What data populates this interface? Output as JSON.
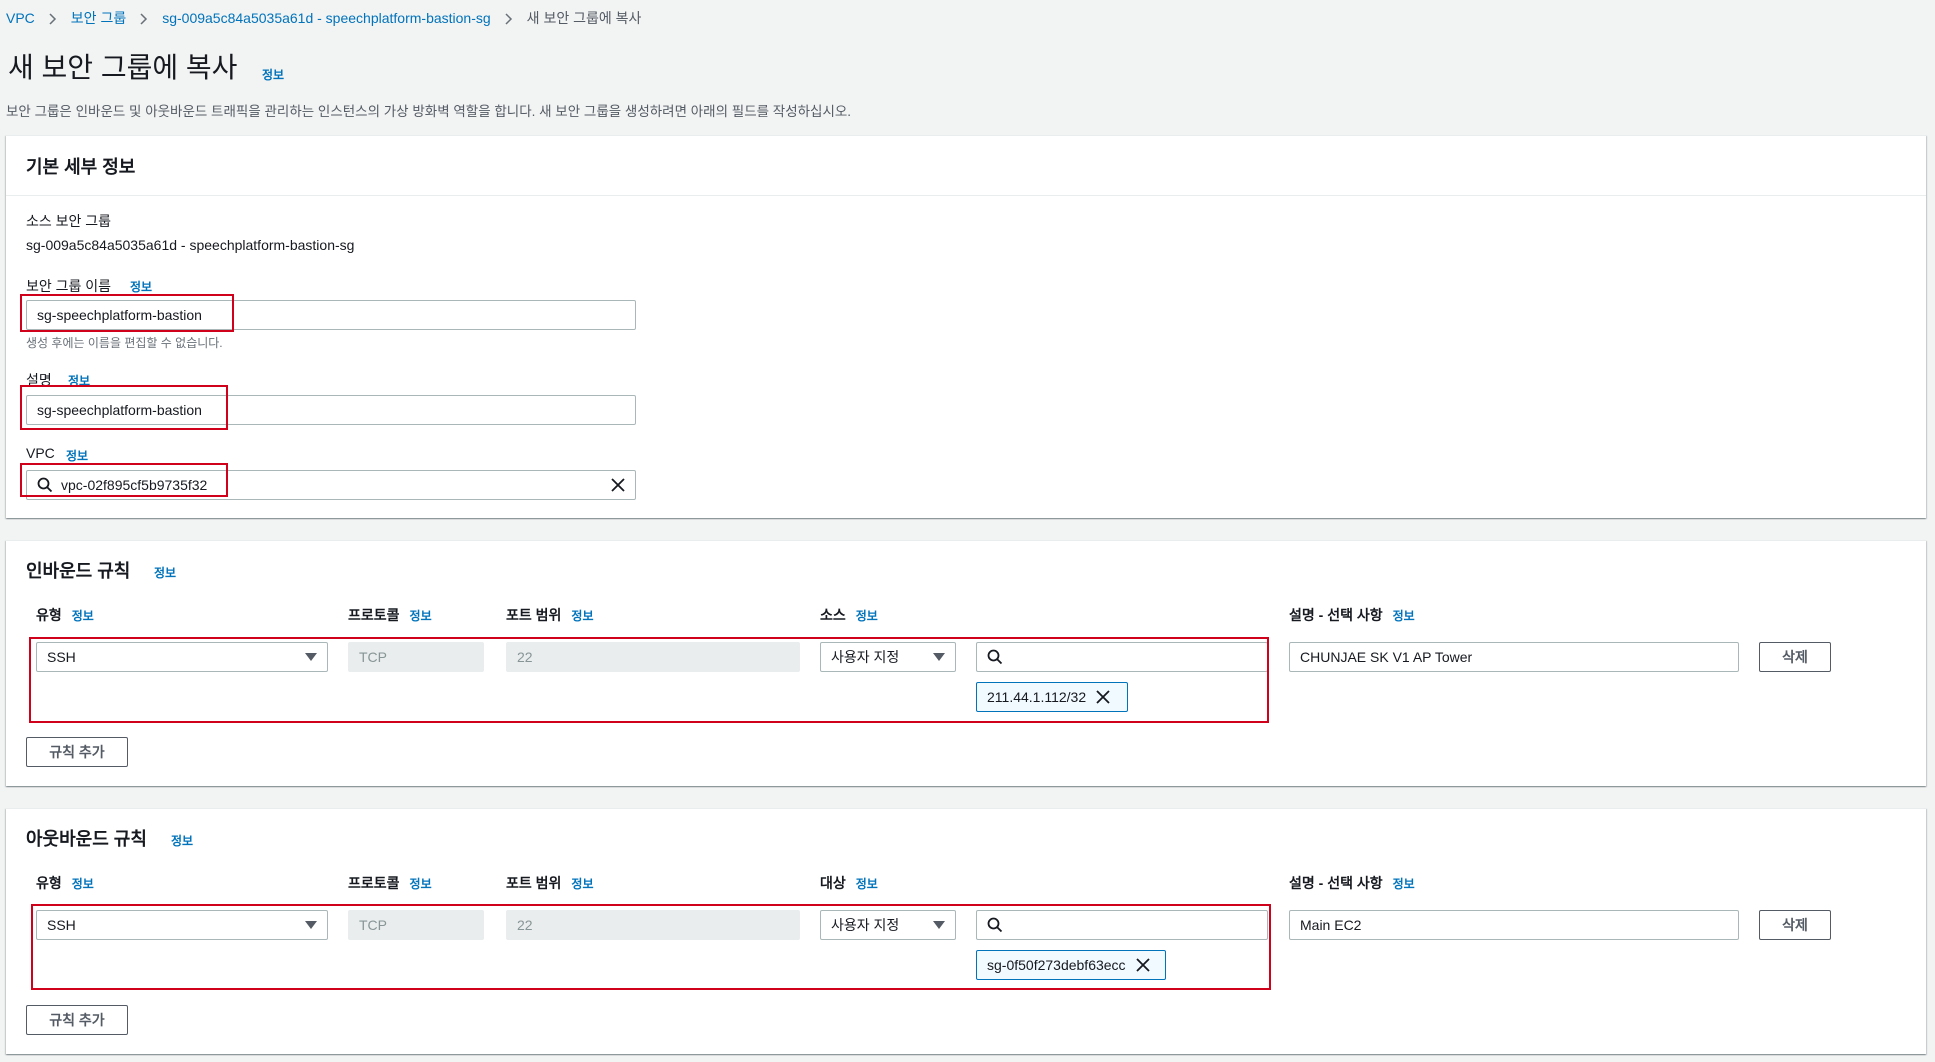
{
  "breadcrumb": {
    "items": [
      "VPC",
      "보안 그룹",
      "sg-009a5c84a5035a61d - speechplatform-bastion-sg"
    ],
    "current": "새 보안 그룹에 복사"
  },
  "page": {
    "title": "새 보안 그룹에 복사",
    "info": "정보",
    "description": "보안 그룹은 인바운드 및 아웃바운드 트래픽을 관리하는 인스턴스의 가상 방화벽 역할을 합니다. 새 보안 그룹을 생성하려면 아래의 필드를 작성하십시오."
  },
  "basic": {
    "title": "기본 세부 정보",
    "source_label": "소스 보안 그룹",
    "source_value": "sg-009a5c84a5035a61d - speechplatform-bastion-sg",
    "name_label": "보안 그룹 이름",
    "name_info": "정보",
    "name_value": "sg-speechplatform-bastion",
    "name_hint": "생성 후에는 이름을 편집할 수 없습니다.",
    "desc_label": "설명",
    "desc_info": "정보",
    "desc_value": "sg-speechplatform-bastion",
    "vpc_label": "VPC",
    "vpc_info": "정보",
    "vpc_value": "vpc-02f895cf5b9735f32"
  },
  "inbound": {
    "title": "인바운드 규칙",
    "info": "정보",
    "col_type": "유형",
    "col_protocol": "프로토콜",
    "col_port": "포트 범위",
    "col_source": "소스",
    "col_desc": "설명 - 선택 사항",
    "col_info": "정보",
    "rule": {
      "type": "SSH",
      "protocol": "TCP",
      "port": "22",
      "source_mode": "사용자 지정",
      "search_value": "",
      "token": "211.44.1.112/32",
      "description": "CHUNJAE SK V1 AP Tower",
      "delete": "삭제"
    },
    "add_rule": "규칙 추가"
  },
  "outbound": {
    "title": "아웃바운드 규칙",
    "info": "정보",
    "col_type": "유형",
    "col_protocol": "프로토콜",
    "col_port": "포트 범위",
    "col_dest": "대상",
    "col_desc": "설명 - 선택 사항",
    "col_info": "정보",
    "rule": {
      "type": "SSH",
      "protocol": "TCP",
      "port": "22",
      "dest_mode": "사용자 지정",
      "search_value": "",
      "token": "sg-0f50f273debf63ecc",
      "description": "Main EC2",
      "delete": "삭제"
    },
    "add_rule": "규칙 추가"
  },
  "icons": [
    "chevron-right-icon",
    "search-icon",
    "close-icon",
    "caret-down-icon"
  ],
  "colors": {
    "link": "#0073bb",
    "highlight": "#d0021b",
    "token_border": "#0073bb"
  }
}
